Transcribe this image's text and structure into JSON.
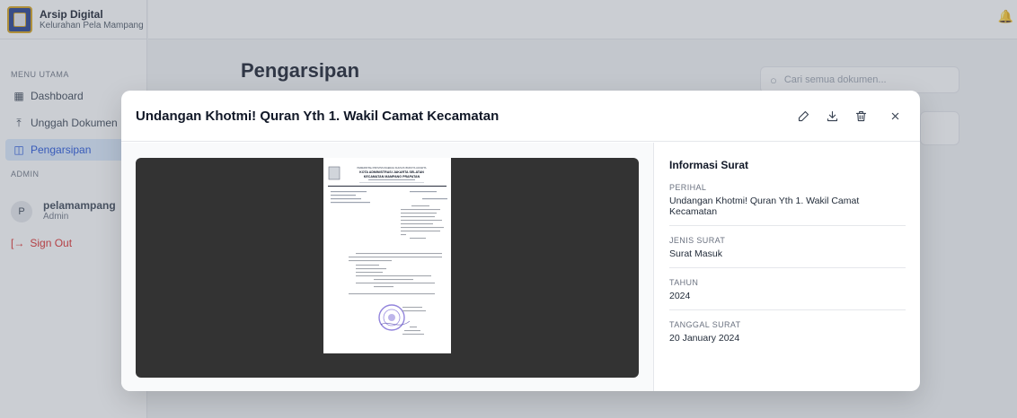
{
  "sidebar": {
    "app_title": "Arsip Digital",
    "app_subtitle": "Kelurahan Pela Mampang",
    "section_main": "MENU UTAMA",
    "items": [
      {
        "label": "Dashboard",
        "icon": "dashboard-icon",
        "active": false
      },
      {
        "label": "Unggah Dokumen",
        "icon": "upload-icon",
        "active": false
      },
      {
        "label": "Pengarsipan",
        "icon": "book-icon",
        "active": true
      }
    ],
    "section_admin": "ADMIN",
    "user": {
      "initial": "P",
      "name": "pelamampang",
      "role": "Admin"
    },
    "signout_label": "Sign Out"
  },
  "header": {
    "page_title": "Pengarsipan"
  },
  "search": {
    "placeholder": "Cari semua dokumen..."
  },
  "modal": {
    "title": "Undangan Khotmi! Quran Yth 1. Wakil Camat Kecamatan",
    "actions": [
      "edit-icon",
      "download-icon",
      "trash-icon",
      "close-icon"
    ],
    "info": {
      "heading": "Informasi Surat",
      "fields": [
        {
          "label": "PERIHAL",
          "value": "Undangan Khotmi! Quran Yth 1. Wakil Camat Kecamatan"
        },
        {
          "label": "JENIS SURAT",
          "value": "Surat Masuk"
        },
        {
          "label": "TAHUN",
          "value": "2024"
        },
        {
          "label": "TANGGAL SURAT",
          "value": "20 January 2024"
        }
      ]
    },
    "document_letterhead": [
      "PEMERINTAH PROVINSI DAERAH KHUSUS IBUKOTA JAKARTA",
      "KOTA ADMINISTRASI JAKARTA SELATAN",
      "KECAMATAN MAMPANG PRAPATAN"
    ]
  },
  "colors": {
    "accent": "#1d4ed8",
    "active_bg": "#dbeafe",
    "danger": "#dc2626",
    "viewer_bg": "#333333"
  }
}
